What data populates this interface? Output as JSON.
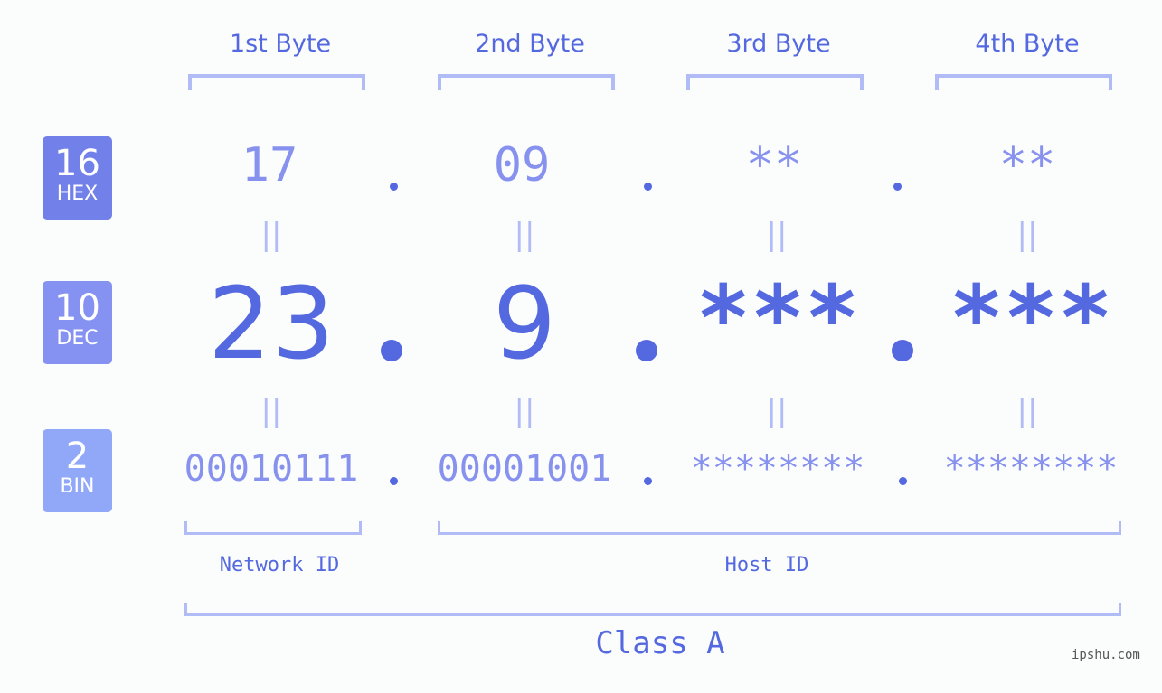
{
  "headers": [
    "1st Byte",
    "2nd Byte",
    "3rd Byte",
    "4th Byte"
  ],
  "badges": [
    {
      "num": "16",
      "label": "HEX",
      "color": "#7280ea"
    },
    {
      "num": "10",
      "label": "DEC",
      "color": "#8592f1"
    },
    {
      "num": "2",
      "label": "BIN",
      "color": "#91a7f8"
    }
  ],
  "hex": [
    "17",
    "09",
    "**",
    "**"
  ],
  "dec": [
    "23",
    "9",
    "***",
    "***"
  ],
  "bin": [
    "00010111",
    "00001001",
    "********",
    "********"
  ],
  "equals_symbol": "||",
  "network_label": "Network ID",
  "host_label": "Host ID",
  "class_label": "Class A",
  "watermark": "ipshu.com",
  "colors": {
    "primary": "#5468e0",
    "secondary": "#8791ee",
    "bracket": "#b1bbf6",
    "background": "#fbfcfc"
  }
}
